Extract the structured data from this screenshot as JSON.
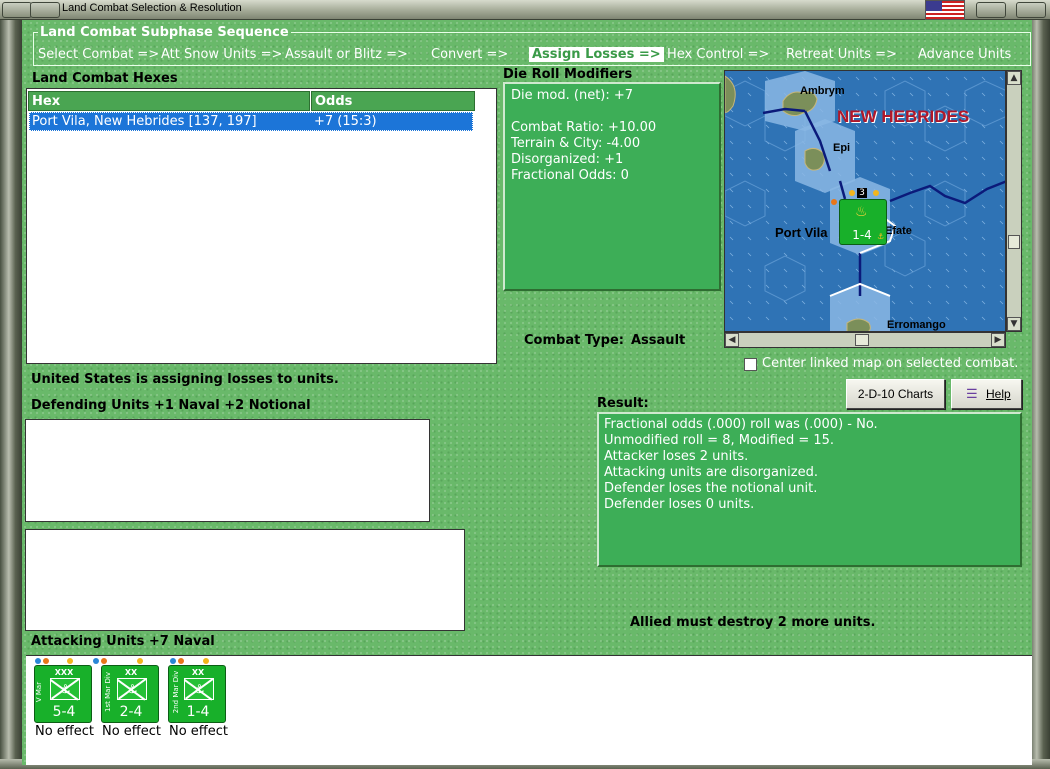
{
  "window": {
    "title": "Land Combat Selection & Resolution"
  },
  "sequence": {
    "title": "Land Combat Subphase Sequence",
    "steps": [
      "Select Combat =>",
      "Att Snow Units =>",
      "Assault or Blitz =>",
      "Convert =>",
      "Assign Losses =>",
      "Hex Control =>",
      "Retreat Units =>",
      "Advance Units"
    ],
    "active_index": 4
  },
  "hexes": {
    "label": "Land Combat Hexes",
    "columns": [
      "Hex",
      "Odds"
    ],
    "rows": [
      {
        "hex": "Port Vila, New Hebrides [137, 197]",
        "odds": "+7 (15:3)"
      }
    ]
  },
  "die_roll": {
    "label": "Die Roll Modifiers",
    "lines": [
      "Die mod. (net): +7",
      "",
      "Combat Ratio: +10.00",
      "Terrain & City: -4.00",
      "Disorganized: +1",
      "Fractional Odds: 0"
    ]
  },
  "map": {
    "labels": {
      "ambrym": "Ambrym",
      "region": "NEW HEBRIDES",
      "epi": "Epi",
      "port_vila": "Port Vila",
      "efate": "Efate",
      "erromango": "Erromango"
    },
    "unit_stack_count": "3",
    "unit_strength": "1-4",
    "center_linked_label": "Center linked map on selected combat.",
    "center_linked_checked": false
  },
  "combat_type": {
    "label": "Combat Type:",
    "value": "Assault"
  },
  "status_message": "United States is assigning losses to units.",
  "defending": {
    "label": "Defending Units +1 Naval +2 Notional"
  },
  "buttons": {
    "charts": "2-D-10 Charts",
    "help": "Help"
  },
  "result": {
    "label": "Result:",
    "lines": [
      "Fractional odds (.000) roll was (.000)  - No.",
      "Unmodified roll = 8, Modified = 15.",
      "Attacker loses 2 units.",
      "Attacking units are disorganized.",
      "Defender loses the notional unit.",
      "Defender loses 0 units."
    ]
  },
  "allied_message": "Allied must destroy 2 more units.",
  "attacking": {
    "label": "Attacking Units +7 Naval",
    "units": [
      {
        "name": "V Mar",
        "size": "XXX",
        "strength": "5-4",
        "effect": "No effect"
      },
      {
        "name": "1st Mar Div",
        "size": "XX",
        "strength": "2-4",
        "effect": "No effect"
      },
      {
        "name": "2nd Mar Div",
        "size": "XX",
        "strength": "1-4",
        "effect": "No effect"
      }
    ]
  },
  "colors": {
    "panel_green": "#69b96a",
    "box_green": "#3dae57",
    "unit_green": "#18b02a",
    "selection_blue": "#1c75d8",
    "sea_blue": "#2f73b5",
    "region_red": "#b0182a"
  }
}
